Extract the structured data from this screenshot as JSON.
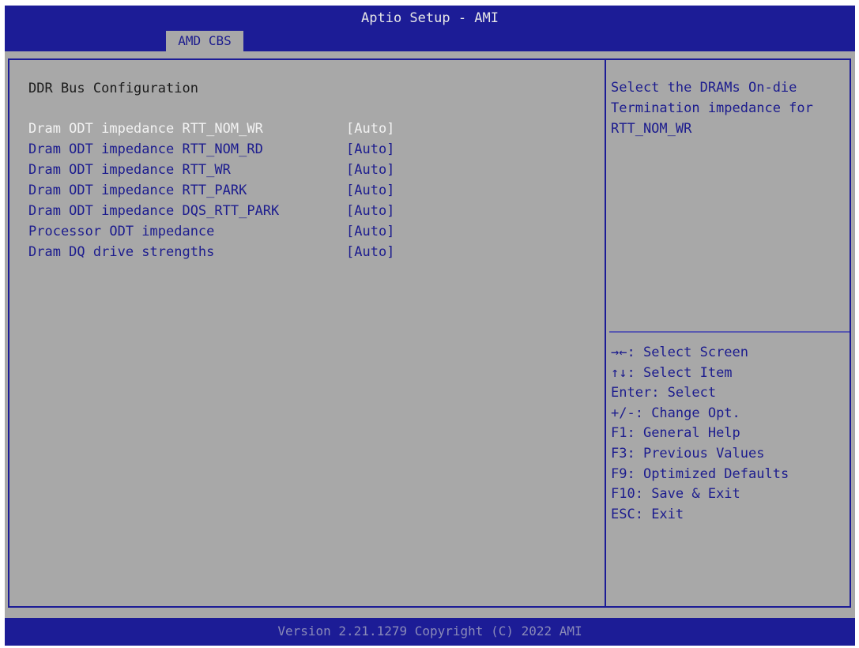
{
  "header": {
    "title": "Aptio Setup - AMI",
    "active_tab": "AMD CBS"
  },
  "main": {
    "section_title": "DDR Bus Configuration",
    "settings": [
      {
        "label": "Dram ODT impedance RTT_NOM_WR",
        "value": "[Auto]",
        "selected": true
      },
      {
        "label": "Dram ODT impedance RTT_NOM_RD",
        "value": "[Auto]",
        "selected": false
      },
      {
        "label": "Dram ODT impedance RTT_WR",
        "value": "[Auto]",
        "selected": false
      },
      {
        "label": "Dram ODT impedance RTT_PARK",
        "value": "[Auto]",
        "selected": false
      },
      {
        "label": "Dram ODT impedance DQS_RTT_PARK",
        "value": "[Auto]",
        "selected": false
      },
      {
        "label": "Processor ODT impedance",
        "value": "[Auto]",
        "selected": false
      },
      {
        "label": "Dram DQ drive strengths",
        "value": "[Auto]",
        "selected": false
      }
    ]
  },
  "help": {
    "description": "Select the DRAMs On-die\nTermination impedance for\nRTT_NOM_WR",
    "keys": [
      {
        "key": "→←",
        "action": ": Select Screen",
        "icon": "left-right-arrows-icon"
      },
      {
        "key": "↑↓",
        "action": ": Select Item",
        "icon": "up-down-arrows-icon"
      },
      {
        "key": "Enter",
        "action": ": Select",
        "icon": ""
      },
      {
        "key": "+/-",
        "action": ": Change Opt.",
        "icon": ""
      },
      {
        "key": "F1",
        "action": ": General Help",
        "icon": ""
      },
      {
        "key": "F3",
        "action": ": Previous Values",
        "icon": ""
      },
      {
        "key": "F9",
        "action": ": Optimized Defaults",
        "icon": ""
      },
      {
        "key": "F10",
        "action": ": Save & Exit",
        "icon": ""
      },
      {
        "key": "ESC",
        "action": ": Exit",
        "icon": ""
      }
    ]
  },
  "footer": {
    "version": "Version 2.21.1279 Copyright (C) 2022 AMI"
  },
  "colors": {
    "background": "#a8a8a8",
    "bar": "#1c1c96",
    "text": "#1c1c8e",
    "selected_text": "#f2f2f2"
  }
}
